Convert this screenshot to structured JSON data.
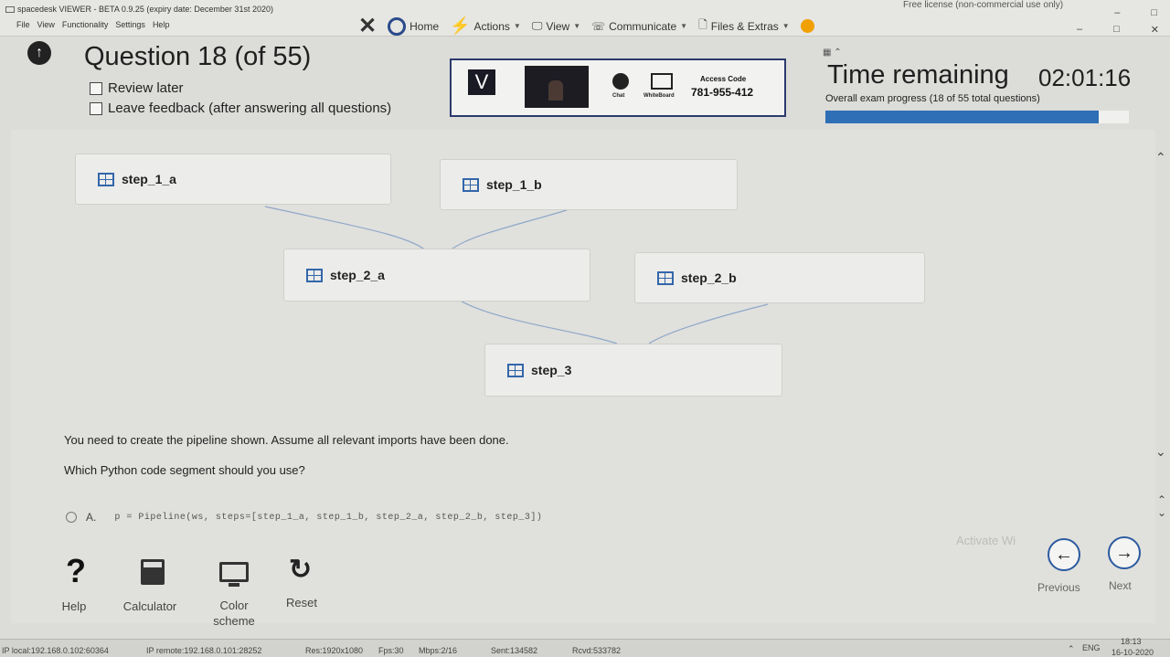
{
  "window": {
    "app_title": "spacedesk VIEWER - BETA 0.9.25 (expiry date: December 31st 2020)",
    "menu": [
      "File",
      "View",
      "Functionality",
      "Settings",
      "Help"
    ],
    "license": "Free license (non-commercial use only)",
    "controls": {
      "minimize": "–",
      "restore": "□",
      "close": "✕"
    }
  },
  "toolbar": {
    "close_glyph": "✕",
    "home": "Home",
    "actions": "Actions",
    "view": "View",
    "communicate": "Communicate",
    "files": "Files & Extras"
  },
  "exam": {
    "title": "Question 18 (of 55)",
    "review_later": "Review later",
    "leave_feedback": "Leave feedback (after answering all questions)",
    "time_label": "Time remaining",
    "time_value": "02:01:16",
    "progress_text": "Overall exam progress (18 of 55 total questions)",
    "progress_fraction": 0.9
  },
  "remote": {
    "v_label": "V",
    "chat_label": "Chat",
    "whiteboard_label": "WhiteBoard",
    "access_code_label": "Access Code",
    "access_code": "781-955-412"
  },
  "pipeline": {
    "nodes": [
      {
        "id": "n1a",
        "label": "step_1_a"
      },
      {
        "id": "n1b",
        "label": "step_1_b"
      },
      {
        "id": "n2a",
        "label": "step_2_a"
      },
      {
        "id": "n2b",
        "label": "step_2_b"
      },
      {
        "id": "n3",
        "label": "step_3"
      }
    ]
  },
  "question": {
    "line1": "You need to create the pipeline shown. Assume all relevant imports have been done.",
    "line2": "Which Python code segment should you use?",
    "option_a_letter": "A.",
    "option_a_code": "p = Pipeline(ws, steps=[step_1_a, step_1_b, step_2_a, step_2_b, step_3])"
  },
  "tools": {
    "help": "Help",
    "calculator": "Calculator",
    "color_scheme_1": "Color",
    "color_scheme_2": "scheme",
    "reset": "Reset"
  },
  "nav": {
    "previous": "Previous",
    "next": "Next",
    "watermark": "Activate Wi"
  },
  "status": {
    "local": "IP local:192.168.0.102:60364",
    "remote": "IP remote:192.168.0.101:28252",
    "res": "Res:1920x1080",
    "fps": "Fps:30",
    "mbps": "Mbps:2/16",
    "sent": "Sent:134582",
    "rcvd": "Rcvd:533782",
    "lang": "ENG",
    "time": "18:13",
    "date": "16-10-2020"
  }
}
